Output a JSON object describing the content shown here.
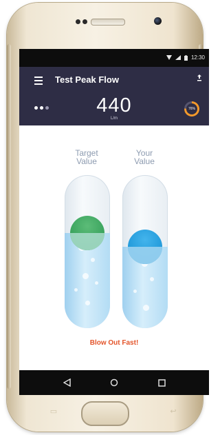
{
  "status": {
    "time": "12:30"
  },
  "app": {
    "title": "Test Peak Flow"
  },
  "reading": {
    "value": "440",
    "unit": "L/m",
    "gauge_label": "76%",
    "gauge_fraction": 0.76
  },
  "columns": [
    {
      "label_line1": "Target",
      "label_line2": "Value",
      "level_fraction": 0.62
    },
    {
      "label_line1": "Your",
      "label_line2": "Value",
      "level_fraction": 0.53
    }
  ],
  "prompt": {
    "message": "Blow Out Fast!"
  },
  "colors": {
    "appbar": "#2e2d45",
    "gauge": "#f3992b",
    "target_ball": "#36a05a",
    "your_ball": "#1e97d8",
    "message": "#e3542a"
  },
  "icons": {
    "menu": "menu-icon",
    "share": "share-icon",
    "back": "nav-back-icon",
    "home": "nav-home-icon",
    "recents": "nav-recents-icon"
  }
}
